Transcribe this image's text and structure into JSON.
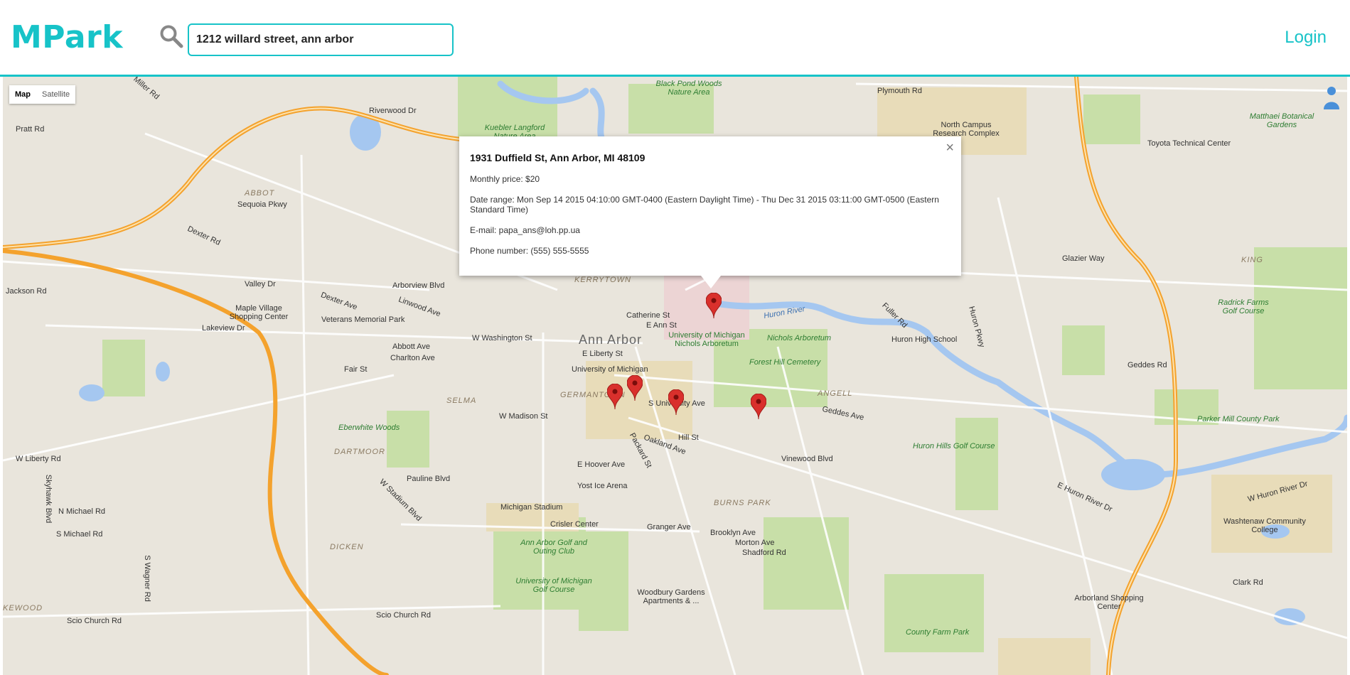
{
  "app": {
    "logo": "MPark",
    "login_label": "Login"
  },
  "search": {
    "value": "1212 willard street, ann arbor"
  },
  "map_controls": {
    "map_label": "Map",
    "satellite_label": "Satellite"
  },
  "info_window": {
    "title": "1931 Duffield St, Ann Arbor, MI 48109",
    "price": "Monthly price: $20",
    "date_range": "Date range: Mon Sep 14 2015 04:10:00 GMT-0400 (Eastern Daylight Time) - Thu Dec 31 2015 03:11:00 GMT-0500 (Eastern Standard Time)",
    "email": "E-mail: papa_ans@loh.pp.ua",
    "phone": "Phone number: (555) 555-5555",
    "close": "×"
  },
  "map_labels": {
    "ann_arbor": "Ann Arbor",
    "miller_rd": "Miller Rd",
    "riverwood": "Riverwood Dr",
    "pratt_rd": "Pratt Rd",
    "abbot": "ABBOT",
    "sequoia": "Sequoia Pkwy",
    "dexter_rd": "Dexter Rd",
    "valley_dr": "Valley Dr",
    "maple_village": "Maple Village Shopping Center",
    "veterans": "Veterans Memorial Park",
    "lakeview": "Lakeview Dr",
    "w_washington": "W Washington St",
    "e_liberty": "E Liberty St",
    "umich": "University of Michigan",
    "umich_arb": "University of Michigan Nichols Arboretum",
    "nichols": "Nichols Arboretum",
    "forest_hill": "Forest Hill Cemetery",
    "huron_river": "Huron River",
    "huron_high": "Huron High School",
    "angell": "ANGELL",
    "geddes_ave": "Geddes Ave",
    "germantown": "GERMANTOWN",
    "selma": "SELMA",
    "w_madison": "W Madison St",
    "s_university": "S University Ave",
    "hill_st": "Hill St",
    "eberwhite": "Eberwhite Woods",
    "dartmoor": "DARTMOOR",
    "w_liberty_rd": "W Liberty Rd",
    "pauline": "Pauline Blvd",
    "yost": "Yost Ice Arena",
    "stadium": "Michigan Stadium",
    "crisler": "Crisler Center",
    "arbor_links": "Ann Arbor Golf and Outing Club",
    "um_golf": "University of Michigan Golf Course",
    "dicken": "DICKEN",
    "woodbury": "Woodbury Gardens Apartments & ...",
    "burns_park": "BURNS PARK",
    "huron_hills": "Huron Hills Golf Course",
    "county_farm": "County Farm Park",
    "arborland": "Arborland Shopping Center",
    "washtenaw_cc": "Washtenaw Community College",
    "parker_mill": "Parker Mill County Park",
    "radrick": "Radrick Farms Golf Course",
    "toyota": "Toyota Technical Center",
    "matthaei": "Matthaei Botanical Gardens",
    "north_campus": "North Campus Research Complex",
    "black_pond": "Black Pond Woods Nature Area",
    "kuebler": "Kuebler Langford Nature Area",
    "plymouth": "Plymouth Rd",
    "glazier": "Glazier Way",
    "king": "KING",
    "kerrytown": "KERRYTOWN",
    "catherine": "Catherine St",
    "e_ann": "E Ann St",
    "vinewood": "Vinewood Blvd",
    "scio_church": "Scio Church Rd",
    "packard": "Packard St",
    "stadium_blvd": "W Stadium Blvd",
    "clark_rd": "Clark Rd",
    "w_huron_river": "W Huron River Dr",
    "s_wagner": "S Wagner Rd",
    "n_michael": "N Michael Rd",
    "s_michael": "S Michael Rd",
    "skyhawk": "Skyhawk Blvd",
    "jackson_rd": "Jackson Rd",
    "fair_st": "Fair St",
    "abbott_ave": "Abbott Ave",
    "charlton": "Charlton Ave",
    "dexter_ave": "Dexter Ave",
    "linwood": "Linwood Ave",
    "arborview": "Arborview Blvd",
    "e_hoover": "E Hoover Ave",
    "granger": "Granger Ave",
    "brooklyn": "Brooklyn Ave",
    "morton": "Morton Ave",
    "shadford": "Shadford Rd",
    "oakland": "Oakland Ave",
    "huron_pkwy": "Huron Pkwy",
    "fuller": "Fuller Rd",
    "e_huron_river": "E Huron River Dr",
    "kewood": "KEWOOD",
    "geddes_rd": "Geddes Rd"
  },
  "colors": {
    "accent": "#17c3c8",
    "marker": "#d9302c",
    "highway": "#f4a22d"
  }
}
